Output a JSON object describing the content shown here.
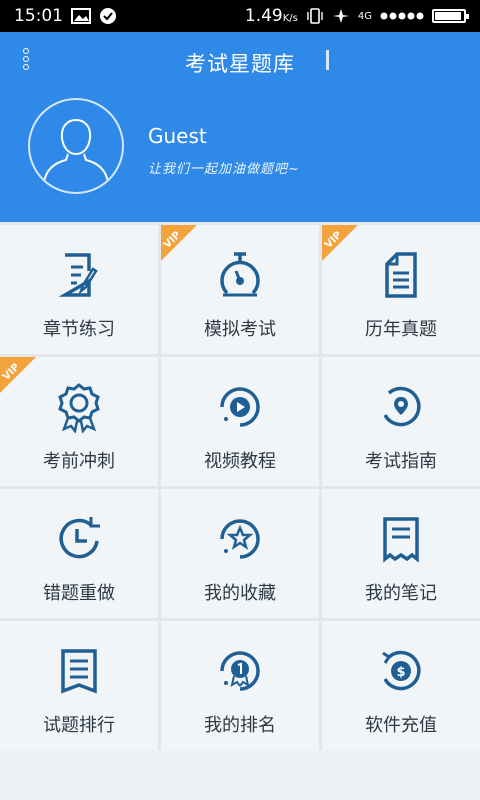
{
  "status_bar": {
    "time": "15:01",
    "speed": "1.49",
    "speed_unit": "K/s",
    "network": "4G",
    "battery_level": 0.92
  },
  "header": {
    "title": "考试星题库",
    "username": "Guest",
    "slogan": "让我们一起加油做题吧~"
  },
  "grid": {
    "vip_label": "VIP",
    "items": [
      {
        "label": "章节练习",
        "icon": "document-edit-icon",
        "vip": false
      },
      {
        "label": "模拟考试",
        "icon": "stopwatch-icon",
        "vip": true
      },
      {
        "label": "历年真题",
        "icon": "document-list-icon",
        "vip": true
      },
      {
        "label": "考前冲刺",
        "icon": "award-badge-icon",
        "vip": true
      },
      {
        "label": "视频教程",
        "icon": "play-circle-icon",
        "vip": false
      },
      {
        "label": "考试指南",
        "icon": "compass-pin-icon",
        "vip": false
      },
      {
        "label": "错题重做",
        "icon": "clock-redo-icon",
        "vip": false
      },
      {
        "label": "我的收藏",
        "icon": "star-circle-icon",
        "vip": false
      },
      {
        "label": "我的笔记",
        "icon": "receipt-note-icon",
        "vip": false
      },
      {
        "label": "试题排行",
        "icon": "ranking-list-icon",
        "vip": false
      },
      {
        "label": "我的排名",
        "icon": "medal-rank-icon",
        "vip": false
      },
      {
        "label": "软件充值",
        "icon": "coin-recharge-icon",
        "vip": false
      }
    ]
  },
  "colors": {
    "header_blue": "#2f89e8",
    "icon_blue": "#1f5f94",
    "vip_orange": "#f2a33c"
  }
}
